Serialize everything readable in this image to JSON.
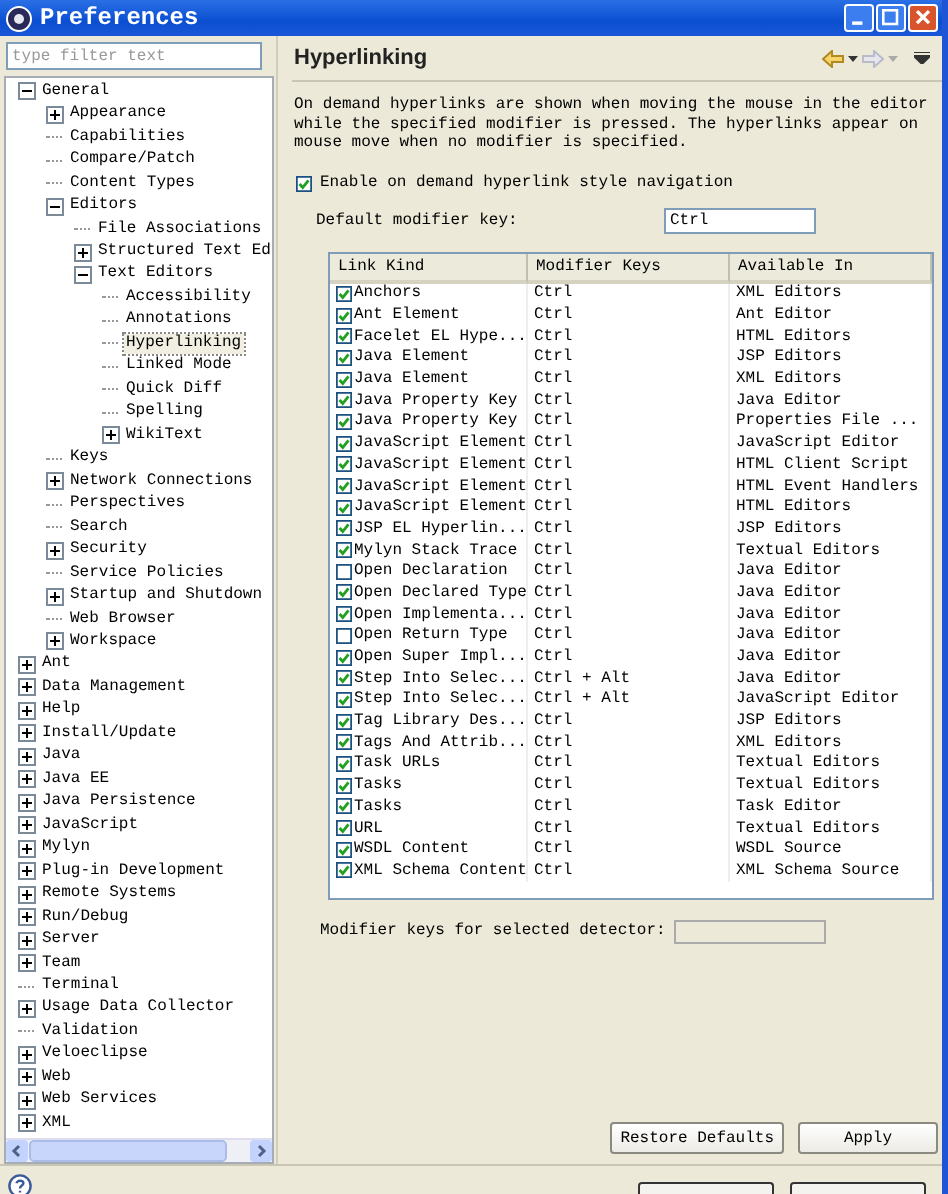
{
  "window": {
    "title": "Preferences"
  },
  "filter": {
    "placeholder": "type filter text"
  },
  "tree": [
    {
      "label": "General",
      "expanded": true,
      "selected": false,
      "children": [
        {
          "label": "Appearance",
          "expanded": false,
          "selected": false
        },
        {
          "label": "Capabilities",
          "selected": false
        },
        {
          "label": "Compare/Patch",
          "selected": false
        },
        {
          "label": "Content Types",
          "selected": false
        },
        {
          "label": "Editors",
          "expanded": true,
          "selected": false,
          "children": [
            {
              "label": "File Associations",
              "selected": false
            },
            {
              "label": "Structured Text Ed",
              "expanded": false,
              "selected": false
            },
            {
              "label": "Text Editors",
              "expanded": true,
              "selected": false,
              "children": [
                {
                  "label": "Accessibility",
                  "selected": false
                },
                {
                  "label": "Annotations",
                  "selected": false
                },
                {
                  "label": "Hyperlinking",
                  "selected": true
                },
                {
                  "label": "Linked Mode",
                  "selected": false
                },
                {
                  "label": "Quick Diff",
                  "selected": false
                },
                {
                  "label": "Spelling",
                  "selected": false
                },
                {
                  "label": "WikiText",
                  "expanded": false,
                  "selected": false
                }
              ]
            }
          ]
        },
        {
          "label": "Keys",
          "selected": false
        },
        {
          "label": "Network Connections",
          "expanded": false,
          "selected": false
        },
        {
          "label": "Perspectives",
          "selected": false
        },
        {
          "label": "Search",
          "selected": false
        },
        {
          "label": "Security",
          "expanded": false,
          "selected": false
        },
        {
          "label": "Service Policies",
          "selected": false
        },
        {
          "label": "Startup and Shutdown",
          "expanded": false,
          "selected": false
        },
        {
          "label": "Web Browser",
          "selected": false
        },
        {
          "label": "Workspace",
          "expanded": false,
          "selected": false
        }
      ]
    },
    {
      "label": "Ant",
      "expanded": false,
      "selected": false
    },
    {
      "label": "Data Management",
      "expanded": false,
      "selected": false
    },
    {
      "label": "Help",
      "expanded": false,
      "selected": false
    },
    {
      "label": "Install/Update",
      "expanded": false,
      "selected": false
    },
    {
      "label": "Java",
      "expanded": false,
      "selected": false
    },
    {
      "label": "Java EE",
      "expanded": false,
      "selected": false
    },
    {
      "label": "Java Persistence",
      "expanded": false,
      "selected": false
    },
    {
      "label": "JavaScript",
      "expanded": false,
      "selected": false
    },
    {
      "label": "Mylyn",
      "expanded": false,
      "selected": false
    },
    {
      "label": "Plug-in Development",
      "expanded": false,
      "selected": false
    },
    {
      "label": "Remote Systems",
      "expanded": false,
      "selected": false
    },
    {
      "label": "Run/Debug",
      "expanded": false,
      "selected": false
    },
    {
      "label": "Server",
      "expanded": false,
      "selected": false
    },
    {
      "label": "Team",
      "expanded": false,
      "selected": false
    },
    {
      "label": "Terminal",
      "selected": false
    },
    {
      "label": "Usage Data Collector",
      "expanded": false,
      "selected": false
    },
    {
      "label": "Validation",
      "selected": false
    },
    {
      "label": "Veloeclipse",
      "expanded": false,
      "selected": false
    },
    {
      "label": "Web",
      "expanded": false,
      "selected": false
    },
    {
      "label": "Web Services",
      "expanded": false,
      "selected": false
    },
    {
      "label": "XML",
      "expanded": false,
      "selected": false
    }
  ],
  "page": {
    "title": "Hyperlinking",
    "description": "On demand hyperlinks are shown when moving the mouse in the editor while the specified modifier is pressed. The hyperlinks appear on mouse move when no modifier is specified.",
    "enable": {
      "label": "Enable on demand hyperlink style navigation",
      "checked": true
    },
    "default_modifier": {
      "label": "Default modifier key:",
      "value": "Ctrl"
    },
    "table": {
      "columns": [
        "Link Kind",
        "Modifier Keys",
        "Available In"
      ],
      "rows": [
        {
          "checked": true,
          "cells": [
            "Anchors",
            "Ctrl",
            "XML Editors"
          ]
        },
        {
          "checked": true,
          "cells": [
            "Ant Element",
            "Ctrl",
            "Ant Editor"
          ]
        },
        {
          "checked": true,
          "cells": [
            "Facelet EL Hype...",
            "Ctrl",
            "HTML Editors"
          ]
        },
        {
          "checked": true,
          "cells": [
            "Java Element",
            "Ctrl",
            "JSP Editors"
          ]
        },
        {
          "checked": true,
          "cells": [
            "Java Element",
            "Ctrl",
            "XML Editors"
          ]
        },
        {
          "checked": true,
          "cells": [
            "Java Property Key",
            "Ctrl",
            "Java Editor"
          ]
        },
        {
          "checked": true,
          "cells": [
            "Java Property Key",
            "Ctrl",
            "Properties File ..."
          ]
        },
        {
          "checked": true,
          "cells": [
            "JavaScript Element",
            "Ctrl",
            "JavaScript Editor"
          ]
        },
        {
          "checked": true,
          "cells": [
            "JavaScript Element",
            "Ctrl",
            "HTML Client Script"
          ]
        },
        {
          "checked": true,
          "cells": [
            "JavaScript Element",
            "Ctrl",
            "HTML Event Handlers"
          ]
        },
        {
          "checked": true,
          "cells": [
            "JavaScript Element",
            "Ctrl",
            "HTML Editors"
          ]
        },
        {
          "checked": true,
          "cells": [
            "JSP EL Hyperlin...",
            "Ctrl",
            "JSP Editors"
          ]
        },
        {
          "checked": true,
          "cells": [
            "Mylyn Stack Trace",
            "Ctrl",
            "Textual Editors"
          ]
        },
        {
          "checked": false,
          "cells": [
            "Open Declaration",
            "Ctrl",
            "Java Editor"
          ]
        },
        {
          "checked": true,
          "cells": [
            "Open Declared Type",
            "Ctrl",
            "Java Editor"
          ]
        },
        {
          "checked": true,
          "cells": [
            "Open Implementa...",
            "Ctrl",
            "Java Editor"
          ]
        },
        {
          "checked": false,
          "cells": [
            "Open Return Type",
            "Ctrl",
            "Java Editor"
          ]
        },
        {
          "checked": true,
          "cells": [
            "Open Super Impl...",
            "Ctrl",
            "Java Editor"
          ]
        },
        {
          "checked": true,
          "cells": [
            "Step Into Selec...",
            "Ctrl + Alt",
            "Java Editor"
          ]
        },
        {
          "checked": true,
          "cells": [
            "Step Into Selec...",
            "Ctrl + Alt",
            "JavaScript Editor"
          ]
        },
        {
          "checked": true,
          "cells": [
            "Tag Library Des...",
            "Ctrl",
            "JSP Editors"
          ]
        },
        {
          "checked": true,
          "cells": [
            "Tags And Attrib...",
            "Ctrl",
            "XML Editors"
          ]
        },
        {
          "checked": true,
          "cells": [
            "Task URLs",
            "Ctrl",
            "Textual Editors"
          ]
        },
        {
          "checked": true,
          "cells": [
            "Tasks",
            "Ctrl",
            "Textual Editors"
          ]
        },
        {
          "checked": true,
          "cells": [
            "Tasks",
            "Ctrl",
            "Task Editor"
          ]
        },
        {
          "checked": true,
          "cells": [
            "URL",
            "Ctrl",
            "Textual Editors"
          ]
        },
        {
          "checked": true,
          "cells": [
            "WSDL Content",
            "Ctrl",
            "WSDL Source"
          ]
        },
        {
          "checked": true,
          "cells": [
            "XML Schema Content",
            "Ctrl",
            "XML Schema Source"
          ]
        }
      ]
    },
    "detector_modifier": {
      "label": "Modifier keys for selected detector:"
    },
    "buttons": [
      "Restore Defaults",
      "Apply"
    ]
  }
}
